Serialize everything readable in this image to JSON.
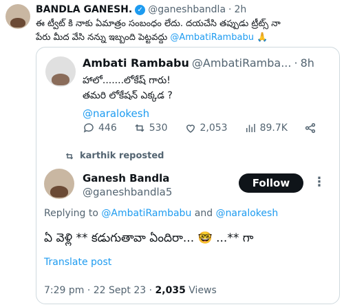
{
  "outer": {
    "author_name": "BANDLA GANESH.",
    "handle": "@ganeshbandla",
    "time": "2h",
    "text_line1": "ఈ ట్వీట్ కి నాకు ఏమాత్రం సంబంధం లేదు. దయచేసి తప్పుడు ట్రీట్స్ నా",
    "text_line2": "పేరు మీద వేసి నన్ను ఇబ్బంది పెట్టవద్దు",
    "mention": "@AmbatiRambabu",
    "emoji": "🙏"
  },
  "quoted": {
    "author_name": "Ambati Rambabu",
    "handle": "@AmbatiRamba...",
    "time": "8h",
    "line1": "హాలో.......లోకేష్ గారు!",
    "line2": "తమరి లోకేషన్ ఎక్కడ ?",
    "mention": "@naralokesh",
    "stats": {
      "replies": "446",
      "reposts": "530",
      "likes": "2,053",
      "views": "89.7K"
    },
    "reposted_by": "karthik reposted"
  },
  "inner": {
    "author_name": "Ganesh Bandla",
    "handle": "@ganeshbandla5",
    "follow_label": "Follow",
    "more_label": "⋮",
    "replying_prefix": "Replying to ",
    "replying_user1": "@AmbatiRambabu",
    "replying_and": " and ",
    "replying_user2": "@naralokesh",
    "text_part1": "ఏ వెళ్లి ** కడుగుతావా ఏందిరా...",
    "text_emoji": "🤓",
    "text_part2": " ...** గా",
    "translate_label": "Translate post",
    "footer_time": "7:29 pm · 22 Sept 23 · ",
    "footer_views_count": "2,035",
    "footer_views_label": " Views"
  }
}
